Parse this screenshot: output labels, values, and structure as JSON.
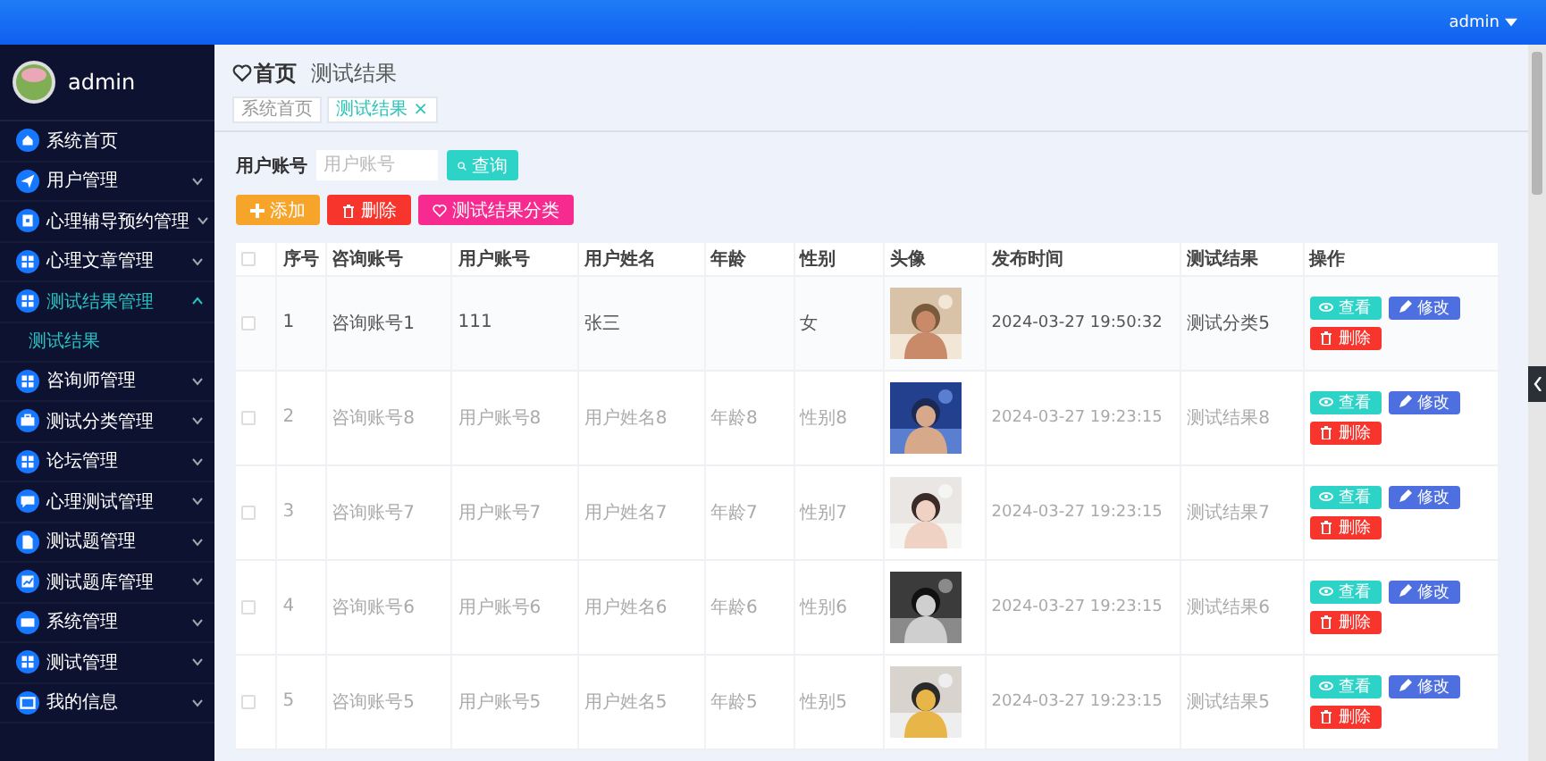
{
  "top_bar": {
    "user": "admin"
  },
  "sidebar": {
    "user": "admin",
    "items": [
      {
        "label": "系统首页",
        "expandable": false,
        "expanded": false
      },
      {
        "label": "用户管理",
        "expandable": true,
        "expanded": false
      },
      {
        "label": "心理辅导预约管理",
        "expandable": true,
        "expanded": false
      },
      {
        "label": "心理文章管理",
        "expandable": true,
        "expanded": false
      },
      {
        "label": "测试结果管理",
        "expandable": true,
        "expanded": true,
        "children": [
          {
            "label": "测试结果",
            "selected": true
          }
        ]
      },
      {
        "label": "咨询师管理",
        "expandable": true,
        "expanded": false
      },
      {
        "label": "测试分类管理",
        "expandable": true,
        "expanded": false
      },
      {
        "label": "论坛管理",
        "expandable": true,
        "expanded": false
      },
      {
        "label": "心理测试管理",
        "expandable": true,
        "expanded": false
      },
      {
        "label": "测试题管理",
        "expandable": true,
        "expanded": false
      },
      {
        "label": "测试题库管理",
        "expandable": true,
        "expanded": false
      },
      {
        "label": "系统管理",
        "expandable": true,
        "expanded": false
      },
      {
        "label": "测试管理",
        "expandable": true,
        "expanded": false
      },
      {
        "label": "我的信息",
        "expandable": true,
        "expanded": false
      }
    ]
  },
  "breadcrumb": {
    "home": "首页",
    "current": "测试结果"
  },
  "tags": [
    {
      "label": "系统首页",
      "selected": false
    },
    {
      "label": "测试结果",
      "selected": true,
      "close": "×"
    }
  ],
  "search": {
    "label": "用户账号",
    "placeholder": "用户账号",
    "button": "查询"
  },
  "toolbar": [
    {
      "kind": "add",
      "label": "添加"
    },
    {
      "kind": "delete",
      "label": "删除"
    },
    {
      "kind": "category",
      "label": "测试结果分类"
    }
  ],
  "table": {
    "header_checked": false,
    "columns": [
      "序号",
      "咨询账号",
      "用户账号",
      "用户姓名",
      "年龄",
      "性别",
      "头像",
      "发布时间",
      "测试结果",
      "操作"
    ],
    "rows": [
      {
        "checked": false,
        "highlighted": true,
        "index": "1",
        "counselor": "咨询账号1",
        "account": "111",
        "name": "张三",
        "gender": "女",
        "time": "2024-03-27 19:50:32",
        "result": "测试分类5",
        "actions": [
          {
            "kind": "view",
            "label": "查看"
          },
          {
            "kind": "edit",
            "label": "修改"
          },
          {
            "kind": "delete",
            "label": "删除"
          }
        ]
      },
      {
        "checked": false,
        "highlighted": false,
        "index": "2",
        "counselor": "咨询账号8",
        "account": "用户账号8",
        "name": "用户姓名8",
        "age": "年龄8",
        "gender": "性别8",
        "time": "2024-03-27 19:23:15",
        "result": "测试结果8",
        "actions": [
          {
            "kind": "view",
            "label": "查看"
          },
          {
            "kind": "edit",
            "label": "修改"
          },
          {
            "kind": "delete",
            "label": "删除"
          }
        ]
      },
      {
        "checked": false,
        "highlighted": false,
        "index": "3",
        "counselor": "咨询账号7",
        "account": "用户账号7",
        "name": "用户姓名7",
        "age": "年龄7",
        "gender": "性别7",
        "time": "2024-03-27 19:23:15",
        "result": "测试结果7",
        "actions": [
          {
            "kind": "view",
            "label": "查看"
          },
          {
            "kind": "edit",
            "label": "修改"
          },
          {
            "kind": "delete",
            "label": "删除"
          }
        ]
      },
      {
        "checked": false,
        "highlighted": false,
        "index": "4",
        "counselor": "咨询账号6",
        "account": "用户账号6",
        "name": "用户姓名6",
        "age": "年龄6",
        "gender": "性别6",
        "time": "2024-03-27 19:23:15",
        "result": "测试结果6",
        "actions": [
          {
            "kind": "view",
            "label": "查看"
          },
          {
            "kind": "edit",
            "label": "修改"
          },
          {
            "kind": "delete",
            "label": "删除"
          }
        ]
      },
      {
        "checked": false,
        "highlighted": false,
        "index": "5",
        "counselor": "咨询账号5",
        "account": "用户账号5",
        "name": "用户姓名5",
        "age": "年龄5",
        "gender": "性别5",
        "time": "2024-03-27 19:23:15",
        "result": "测试结果5",
        "actions": [
          {
            "kind": "view",
            "label": "查看"
          },
          {
            "kind": "edit",
            "label": "修改"
          },
          {
            "kind": "delete",
            "label": "删除"
          }
        ]
      }
    ]
  }
}
